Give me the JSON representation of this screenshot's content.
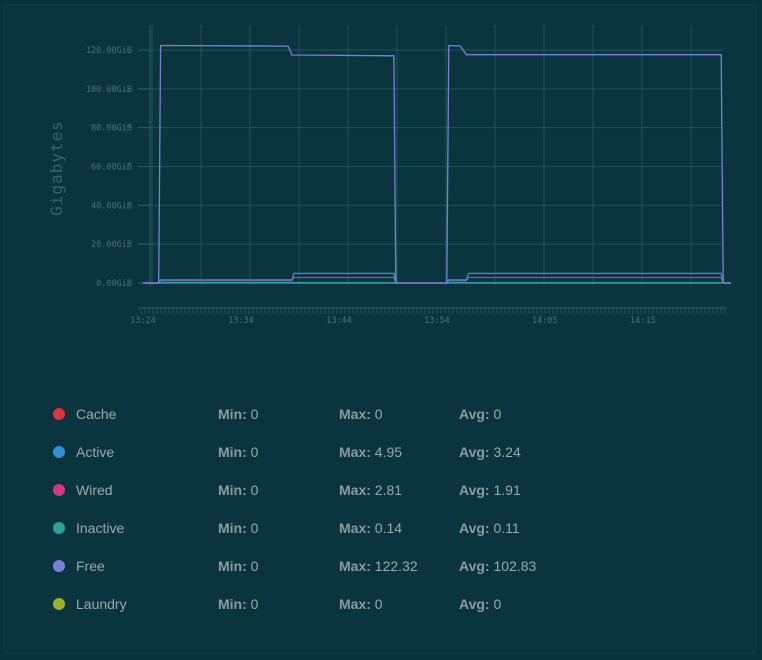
{
  "chart_data": {
    "type": "line",
    "ylabel": "Gigabytes",
    "ylim": [
      0,
      120
    ],
    "yticks": [
      "0.00GiB",
      "20.00GiB",
      "40.00GiB",
      "60.00GiB",
      "80.00GiB",
      "100.00GiB",
      "120.00GiB"
    ],
    "ytick_values": [
      0,
      20,
      40,
      60,
      80,
      100,
      120
    ],
    "xticks": [
      "13:24",
      "13:34",
      "13:44",
      "13:54",
      "14:05",
      "14:15"
    ],
    "xtick_values": [
      0,
      10,
      20,
      30,
      41,
      51
    ],
    "xlim": [
      0,
      60
    ],
    "grid": true,
    "series": [
      {
        "name": "Cache",
        "color": "#e0323a",
        "x": [
          0,
          1.6,
          1.8,
          25.6,
          25.8,
          31,
          31.2,
          59
        ],
        "y": [
          0,
          0,
          0,
          0,
          0,
          0,
          0,
          0
        ]
      },
      {
        "name": "Active",
        "color": "#2f8fd2",
        "x": [
          0,
          1.6,
          1.8,
          15.2,
          15.4,
          25.6,
          25.8,
          31,
          31.2,
          33,
          33.2,
          59,
          59.2,
          60
        ],
        "y": [
          0,
          0,
          1.6,
          1.6,
          4.95,
          4.95,
          0,
          0,
          1.6,
          1.6,
          4.95,
          4.95,
          0,
          0
        ]
      },
      {
        "name": "Wired",
        "color": "#d6357f",
        "x": [
          0,
          1.6,
          1.8,
          15.2,
          15.4,
          25.6,
          25.8,
          31,
          31.2,
          33,
          33.2,
          59,
          59.2,
          60
        ],
        "y": [
          0,
          0,
          1.2,
          1.2,
          2.81,
          2.81,
          0,
          0,
          1.2,
          1.2,
          2.81,
          2.81,
          0,
          0
        ]
      },
      {
        "name": "Inactive",
        "color": "#2aa49a",
        "x": [
          0,
          1.6,
          1.8,
          25.6,
          25.8,
          31,
          31.2,
          59,
          59.2,
          60
        ],
        "y": [
          0,
          0,
          0.14,
          0.14,
          0,
          0,
          0.14,
          0.14,
          0,
          0
        ]
      },
      {
        "name": "Free",
        "color": "#7a7fd6",
        "x": [
          0,
          1.6,
          1.8,
          14.8,
          15.2,
          25.6,
          25.8,
          31,
          31.2,
          32.4,
          33,
          59,
          59.2,
          60
        ],
        "y": [
          0,
          0,
          122.32,
          122,
          117.4,
          117,
          0,
          0,
          122.32,
          122,
          117.6,
          117.6,
          0,
          0
        ]
      },
      {
        "name": "Laundry",
        "color": "#9cb02a",
        "x": [
          0,
          60
        ],
        "y": [
          0,
          0
        ]
      }
    ]
  },
  "legend": [
    {
      "name": "Cache",
      "color": "#e0323a",
      "min_label": "Min:",
      "min": "0",
      "max_label": "Max:",
      "max": "0",
      "avg_label": "Avg:",
      "avg": "0"
    },
    {
      "name": "Active",
      "color": "#2f8fd2",
      "min_label": "Min:",
      "min": "0",
      "max_label": "Max:",
      "max": "4.95",
      "avg_label": "Avg:",
      "avg": "3.24"
    },
    {
      "name": "Wired",
      "color": "#d6357f",
      "min_label": "Min:",
      "min": "0",
      "max_label": "Max:",
      "max": "2.81",
      "avg_label": "Avg:",
      "avg": "1.91"
    },
    {
      "name": "Inactive",
      "color": "#2aa49a",
      "min_label": "Min:",
      "min": "0",
      "max_label": "Max:",
      "max": "0.14",
      "avg_label": "Avg:",
      "avg": "0.11"
    },
    {
      "name": "Free",
      "color": "#7a7fd6",
      "min_label": "Min:",
      "min": "0",
      "max_label": "Max:",
      "max": "122.32",
      "avg_label": "Avg:",
      "avg": "102.83"
    },
    {
      "name": "Laundry",
      "color": "#9cb02a",
      "min_label": "Min:",
      "min": "0",
      "max_label": "Max:",
      "max": "0",
      "avg_label": "Avg:",
      "avg": "0"
    }
  ]
}
